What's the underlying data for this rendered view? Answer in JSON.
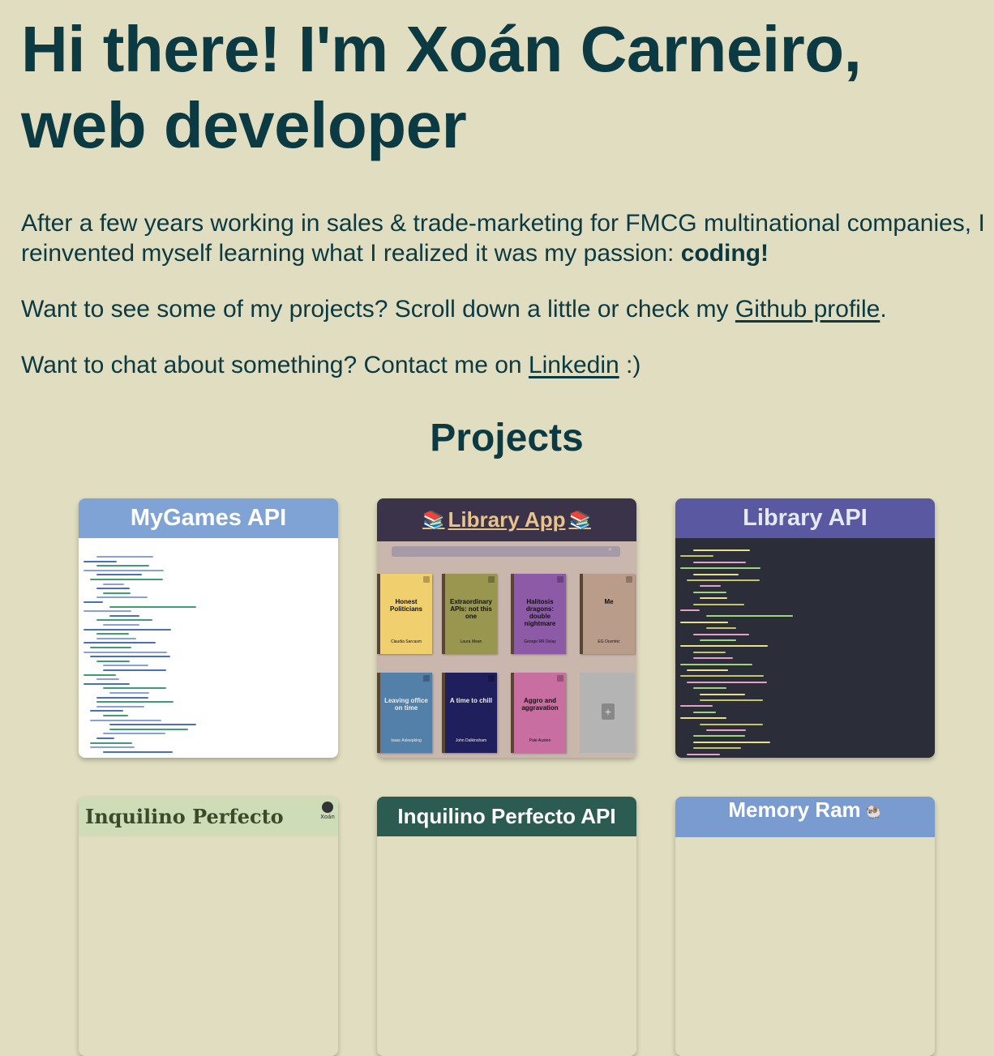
{
  "hero": {
    "title_line1": "Hi there! I'm Xoán Carneiro,",
    "title_line2": "web developer"
  },
  "intro": {
    "p1_text": "After a few years working in sales & trade-marketing for FMCG multinational companies, I reinvented myself learning what I realized it was my passion: ",
    "p1_bold": "coding!",
    "p2_text": "Want to see some of my projects? Scroll down a little or check my ",
    "p2_link": "Github profile",
    "p2_end": ".",
    "p3_text": "Want to chat about something? Contact me on ",
    "p3_link": "Linkedin",
    "p3_end": " :)"
  },
  "projects": {
    "heading": "Projects",
    "cards": [
      {
        "title": "MyGames API"
      },
      {
        "title": "Library App",
        "emoji": "📚"
      },
      {
        "title": "Library API"
      },
      {
        "title": "Inquilino Perfecto",
        "logo_text": "Xoán"
      },
      {
        "title": "Inquilino Perfecto API"
      },
      {
        "title": "Memory Ram",
        "emoji": "🐏"
      }
    ]
  },
  "library_app": {
    "search_icon": "search-icon",
    "books": [
      {
        "title": "Honest Politicians",
        "author": "Claudia Sarcasm",
        "color": "#f0cf6e"
      },
      {
        "title": "Extraordinary APIs: not this one",
        "author": "Laura Mean",
        "color": "#999650"
      },
      {
        "title": "Halitosis dragons: double nightmare",
        "author": "George RR Delay",
        "color": "#8d5aa7"
      },
      {
        "title": "Me",
        "author": "EG Ocentric",
        "color": "#b99c8a"
      },
      {
        "title": "Leaving office on time",
        "author": "Isaac Asleepking",
        "color": "#5380a8"
      },
      {
        "title": "A time to chill",
        "author": "John Dalkinsham",
        "color": "#1f1f5e"
      },
      {
        "title": "Aggro and aggravation",
        "author": "Pale Austen",
        "color": "#c96ea0"
      }
    ]
  },
  "colors": {
    "background": "#e0ddc0",
    "text": "#0b3a42"
  }
}
